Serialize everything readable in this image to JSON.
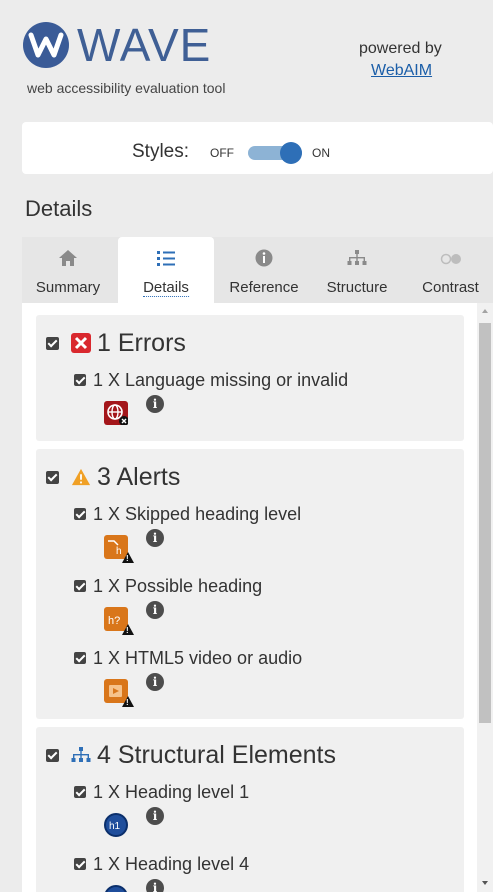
{
  "header": {
    "title": "WAVE",
    "subtitle": "web accessibility evaluation tool",
    "powered_by": "powered by",
    "webaim": "WebAIM"
  },
  "styles": {
    "label": "Styles:",
    "off": "OFF",
    "on": "ON",
    "state": "on"
  },
  "section_title": "Details",
  "tabs": [
    {
      "label": "Summary",
      "icon": "home-icon"
    },
    {
      "label": "Details",
      "icon": "list-icon",
      "active": true
    },
    {
      "label": "Reference",
      "icon": "info-icon"
    },
    {
      "label": "Structure",
      "icon": "structure-icon"
    },
    {
      "label": "Contrast",
      "icon": "contrast-icon"
    }
  ],
  "categories": {
    "errors": {
      "title": "1 Errors",
      "items": [
        {
          "text": "1 X Language missing or invalid",
          "icon": "language-error-icon"
        }
      ]
    },
    "alerts": {
      "title": "3 Alerts",
      "items": [
        {
          "text": "1 X Skipped heading level",
          "icon": "skipped-heading-icon"
        },
        {
          "text": "1 X Possible heading",
          "icon": "possible-heading-icon"
        },
        {
          "text": "1 X HTML5 video or audio",
          "icon": "video-audio-icon"
        }
      ]
    },
    "structure": {
      "title": "4 Structural Elements",
      "items": [
        {
          "text": "1 X Heading level 1",
          "icon": "h1-icon"
        },
        {
          "text": "1 X Heading level 4",
          "icon": "h4-icon"
        }
      ]
    }
  },
  "colors": {
    "error": "#d9282e",
    "alert": "#f0a025",
    "structure": "#2e6fb7",
    "brand": "#3f5f95",
    "link": "#1b5ea8"
  }
}
